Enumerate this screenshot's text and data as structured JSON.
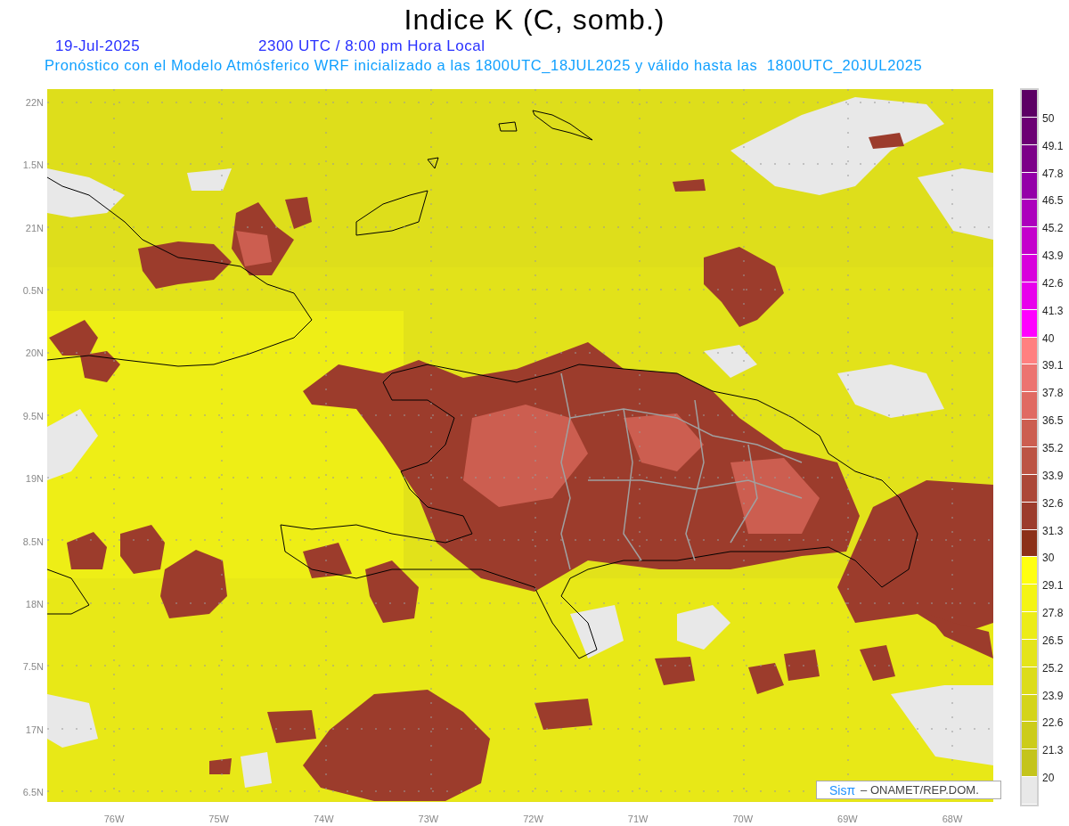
{
  "title": "Indice K (C, somb.)",
  "date": "19-Jul-2025",
  "time": "2300 UTC / 8:00 pm Hora Local",
  "description": "Pronóstico con el Modelo Atmósferico WRF inicializado a las 1800UTC_18JUL2025 y válido hasta las  1800UTC_20JUL2025",
  "y_axis": [
    "22N",
    "1.5N",
    "21N",
    "0.5N",
    "20N",
    "9.5N",
    "19N",
    "8.5N",
    "18N",
    "7.5N",
    "17N",
    "6.5N"
  ],
  "x_axis": [
    "76W",
    "75W",
    "74W",
    "73W",
    "72W",
    "71W",
    "70W",
    "69W",
    "68W"
  ],
  "credit": {
    "brand": "Sisπ",
    "text": "– ONAMET/REP.DOM."
  },
  "colorbar": [
    {
      "color": "#5c0064",
      "label": "50"
    },
    {
      "color": "#6c0074",
      "label": "49.1"
    },
    {
      "color": "#7c0088",
      "label": "47.8"
    },
    {
      "color": "#9400a8",
      "label": "46.5"
    },
    {
      "color": "#ac00bc",
      "label": "45.2"
    },
    {
      "color": "#c400cc",
      "label": "43.9"
    },
    {
      "color": "#d800dc",
      "label": "42.6"
    },
    {
      "color": "#e800ec",
      "label": "41.3"
    },
    {
      "color": "#ff00ff",
      "label": "40"
    },
    {
      "color": "#ff8080",
      "label": "39.1"
    },
    {
      "color": "#ec7470",
      "label": "37.8"
    },
    {
      "color": "#e06a62",
      "label": "36.5"
    },
    {
      "color": "#cc5e50",
      "label": "35.2"
    },
    {
      "color": "#bc5444",
      "label": "33.9"
    },
    {
      "color": "#ac4838",
      "label": "32.6"
    },
    {
      "color": "#9c3c2c",
      "label": "31.3"
    },
    {
      "color": "#8c3018",
      "label": "30"
    },
    {
      "color": "#ffff10",
      "label": "29.1"
    },
    {
      "color": "#f4f414",
      "label": "27.8"
    },
    {
      "color": "#ecec18",
      "label": "26.5"
    },
    {
      "color": "#e4e41a",
      "label": "25.2"
    },
    {
      "color": "#dcdc1a",
      "label": "23.9"
    },
    {
      "color": "#d4d41a",
      "label": "22.6"
    },
    {
      "color": "#cccc1a",
      "label": "21.3"
    },
    {
      "color": "#c4c41c",
      "label": "20"
    },
    {
      "color": "#e8e8e8"
    }
  ]
}
